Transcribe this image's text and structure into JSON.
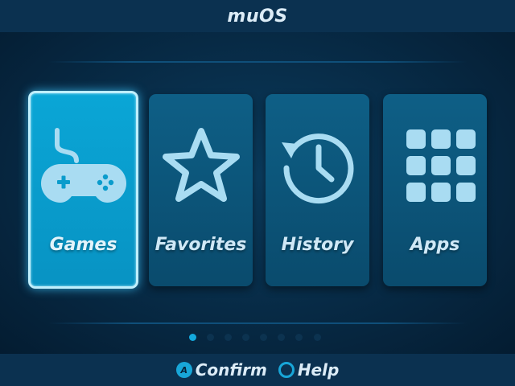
{
  "header": {
    "title": "muOS"
  },
  "menu": {
    "items": [
      {
        "label": "Games",
        "icon": "gamepad-icon",
        "selected": true
      },
      {
        "label": "Favorites",
        "icon": "star-icon",
        "selected": false
      },
      {
        "label": "History",
        "icon": "history-icon",
        "selected": false
      },
      {
        "label": "Apps",
        "icon": "apps-grid-icon",
        "selected": false
      }
    ]
  },
  "pagination": {
    "total": 8,
    "current": 1
  },
  "footer": {
    "confirm_button": "A",
    "confirm_label": "Confirm",
    "help_label": "Help"
  },
  "colors": {
    "accent": "#18a6d8",
    "selected_card": "#0aa6d6",
    "card": "#0a4b6d",
    "background": "#041a2e",
    "bar": "#0b3150"
  }
}
